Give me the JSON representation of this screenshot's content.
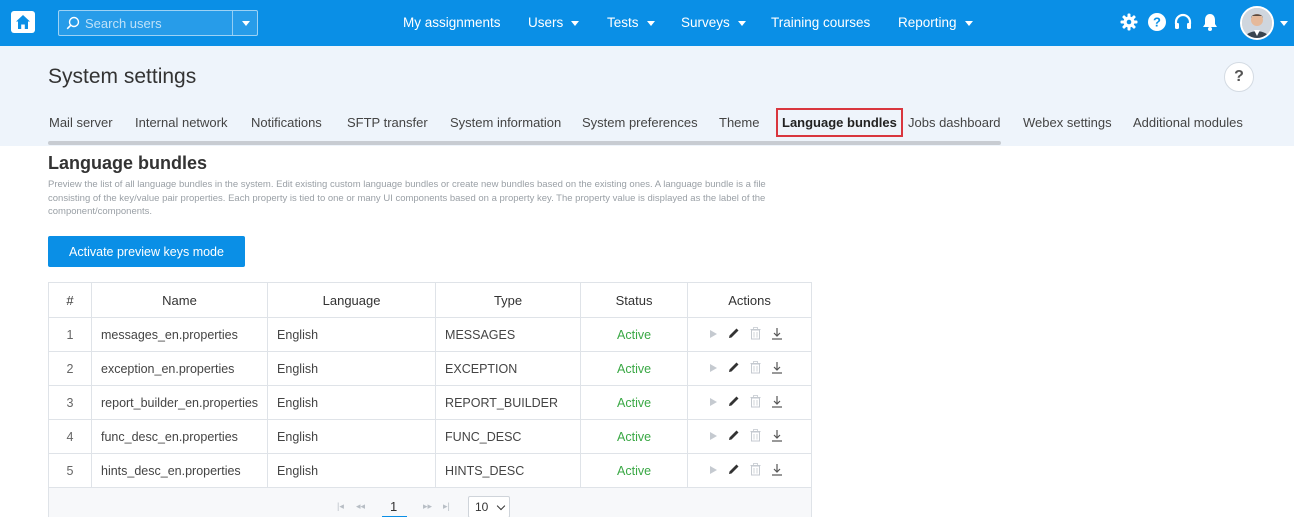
{
  "navbar": {
    "search_placeholder": "Search users",
    "items": [
      {
        "label": "My assignments"
      },
      {
        "label": "Users"
      },
      {
        "label": "Tests"
      },
      {
        "label": "Surveys"
      },
      {
        "label": "Training courses"
      },
      {
        "label": "Reporting"
      }
    ],
    "icons": [
      "home-icon",
      "search-icon",
      "gear-icon",
      "help-icon",
      "headset-icon",
      "bell-icon",
      "avatar"
    ],
    "color": "#0a8fe6"
  },
  "header": {
    "title": "System settings",
    "help": "?",
    "tabs": [
      {
        "label": "Mail server"
      },
      {
        "label": "Internal network"
      },
      {
        "label": "Notifications"
      },
      {
        "label": "SFTP transfer"
      },
      {
        "label": "System information"
      },
      {
        "label": "System preferences"
      },
      {
        "label": "Theme"
      },
      {
        "label": "Language bundles"
      },
      {
        "label": "Jobs dashboard"
      },
      {
        "label": "Webex settings"
      },
      {
        "label": "Additional modules"
      }
    ],
    "active_tab": "Language bundles"
  },
  "section": {
    "title": "Language bundles",
    "description": "Preview the list of all language bundles in the system. Edit existing custom language bundles or create new bundles based on the existing ones. A language bundle is a file consisting of the key/value pair properties. Each property is tied to one or many UI components based on a property key. The property value is displayed as the label of the component/components.",
    "button_label": "Activate preview keys mode"
  },
  "table": {
    "headers": [
      "#",
      "Name",
      "Language",
      "Type",
      "Status",
      "Actions"
    ],
    "rows": [
      {
        "num": "1",
        "name": "messages_en.properties",
        "language": "English",
        "type": "MESSAGES",
        "status": "Active"
      },
      {
        "num": "2",
        "name": "exception_en.properties",
        "language": "English",
        "type": "EXCEPTION",
        "status": "Active"
      },
      {
        "num": "3",
        "name": "report_builder_en.properties",
        "language": "English",
        "type": "REPORT_BUILDER",
        "status": "Active"
      },
      {
        "num": "4",
        "name": "func_desc_en.properties",
        "language": "English",
        "type": "FUNC_DESC",
        "status": "Active"
      },
      {
        "num": "5",
        "name": "hints_desc_en.properties",
        "language": "English",
        "type": "HINTS_DESC",
        "status": "Active"
      }
    ],
    "action_icons": [
      "play-icon",
      "pencil-icon",
      "trash-icon",
      "download-icon"
    ],
    "status_color": "#3aa845"
  },
  "pagination": {
    "current_page": "1",
    "page_size": "10"
  }
}
